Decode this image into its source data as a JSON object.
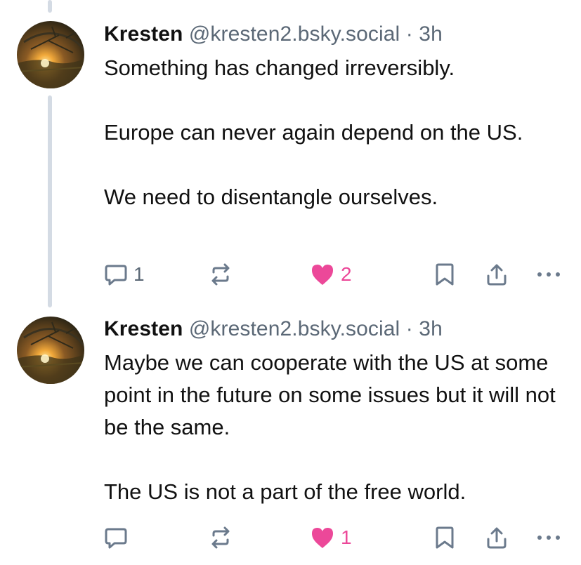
{
  "colors": {
    "thread_line": "#d4dbe4",
    "action_icon": "#6b7a8c",
    "like_active": "#ec4899",
    "handle_gray": "#5b6876"
  },
  "posts": [
    {
      "author": "Kresten",
      "handle": "@kresten2.bsky.social",
      "separator": "·",
      "time": "3h",
      "paragraphs": [
        "Something has changed irreversibly.",
        "Europe can never again depend on the US.",
        "We need to disentangle ourselves."
      ],
      "reply_count": "1",
      "repost_count": "",
      "like_count": "2",
      "liked": true,
      "icons": [
        "reply-icon",
        "repost-icon",
        "heart-icon",
        "bookmark-icon",
        "share-icon",
        "more-icon"
      ]
    },
    {
      "author": "Kresten",
      "handle": "@kresten2.bsky.social",
      "separator": "·",
      "time": "3h",
      "paragraphs": [
        "Maybe we can cooperate with the US at some point in the future on some issues but it will not be the same.",
        "The US is not a part of the free world."
      ],
      "reply_count": "",
      "repost_count": "",
      "like_count": "1",
      "liked": true,
      "icons": [
        "reply-icon",
        "repost-icon",
        "heart-icon",
        "bookmark-icon",
        "share-icon",
        "more-icon"
      ]
    }
  ]
}
